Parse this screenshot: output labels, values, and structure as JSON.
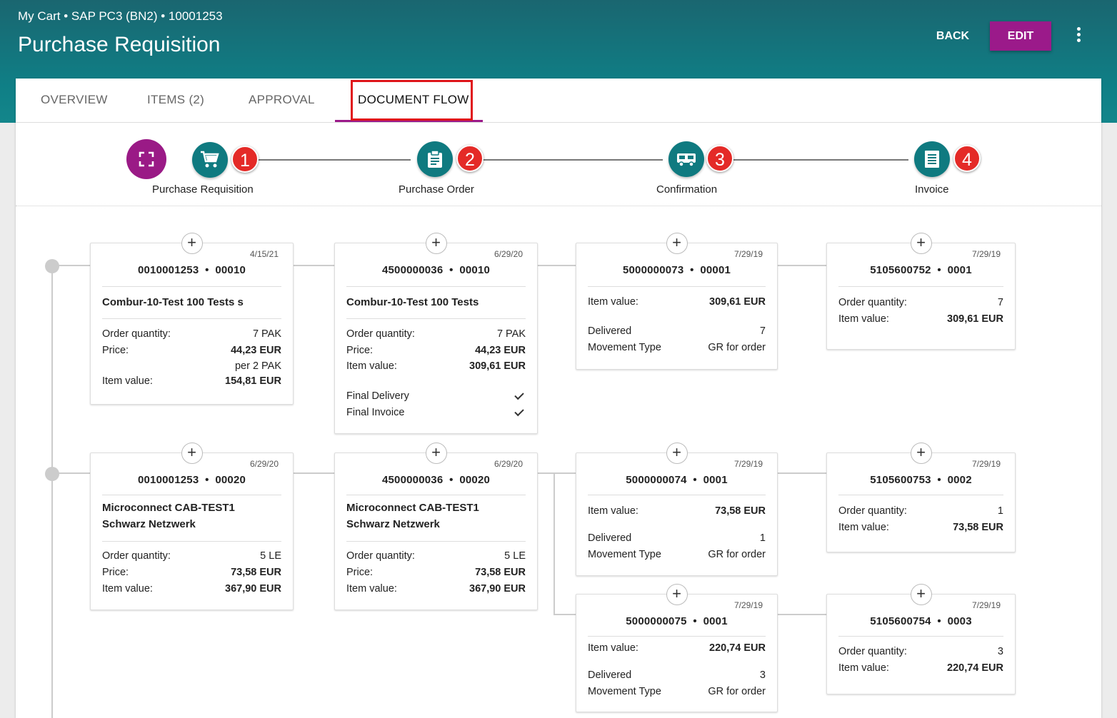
{
  "header": {
    "breadcrumb": "My Cart • SAP PC3 (BN2) • 10001253",
    "title": "Purchase Requisition",
    "back_label": "BACK",
    "edit_label": "EDIT"
  },
  "tabs": [
    {
      "label": "OVERVIEW"
    },
    {
      "label": "ITEMS (2)"
    },
    {
      "label": "APPROVAL"
    },
    {
      "label": "DOCUMENT FLOW"
    }
  ],
  "steps": [
    {
      "label": "Purchase Requisition",
      "badge": "1",
      "icon": "cart-icon"
    },
    {
      "label": "Purchase Order",
      "badge": "2",
      "icon": "clipboard-icon"
    },
    {
      "label": "Confirmation",
      "badge": "3",
      "icon": "truck-icon"
    },
    {
      "label": "Invoice",
      "badge": "4",
      "icon": "document-icon"
    }
  ],
  "docs": {
    "pr1": {
      "date": "4/15/21",
      "number": "0010001253",
      "item": "00010",
      "name": "Combur-10-Test 100 Tests s",
      "qty_label": "Order quantity:",
      "qty": "7 PAK",
      "price_label": "Price:",
      "price": "44,23 EUR",
      "per": "per 2 PAK",
      "value_label": "Item value:",
      "value": "154,81 EUR"
    },
    "po1": {
      "date": "6/29/20",
      "number": "4500000036",
      "item": "00010",
      "name": "Combur-10-Test 100 Tests",
      "qty_label": "Order quantity:",
      "qty": "7 PAK",
      "price_label": "Price:",
      "price": "44,23 EUR",
      "value_label": "Item value:",
      "value": "309,61 EUR",
      "final_delivery": "Final Delivery",
      "final_invoice": "Final Invoice"
    },
    "cf1": {
      "date": "7/29/19",
      "number": "5000000073",
      "item": "00001",
      "value_label": "Item value:",
      "value": "309,61 EUR",
      "delivered_label": "Delivered",
      "delivered": "7",
      "movement_label": "Movement Type",
      "movement": "GR for order"
    },
    "iv1": {
      "date": "7/29/19",
      "number": "5105600752",
      "item": "0001",
      "qty_label": "Order quantity:",
      "qty": "7",
      "value_label": "Item value:",
      "value": "309,61 EUR"
    },
    "pr2": {
      "date": "6/29/20",
      "number": "0010001253",
      "item": "00020",
      "name1": "Microconnect CAB-TEST1",
      "name2": "Schwarz Netzwerk",
      "qty_label": "Order quantity:",
      "qty": "5 LE",
      "price_label": "Price:",
      "price": "73,58 EUR",
      "value_label": "Item value:",
      "value": "367,90 EUR"
    },
    "po2": {
      "date": "6/29/20",
      "number": "4500000036",
      "item": "00020",
      "name1": "Microconnect CAB-TEST1",
      "name2": "Schwarz Netzwerk",
      "qty_label": "Order quantity:",
      "qty": "5 LE",
      "price_label": "Price:",
      "price": "73,58 EUR",
      "value_label": "Item value:",
      "value": "367,90 EUR"
    },
    "cf2": {
      "date": "7/29/19",
      "number": "5000000074",
      "item": "0001",
      "value_label": "Item value:",
      "value": "73,58 EUR",
      "delivered_label": "Delivered",
      "delivered": "1",
      "movement_label": "Movement Type",
      "movement": "GR for order"
    },
    "iv2": {
      "date": "7/29/19",
      "number": "5105600753",
      "item": "0002",
      "qty_label": "Order quantity:",
      "qty": "1",
      "value_label": "Item value:",
      "value": "73,58 EUR"
    },
    "cf3": {
      "date": "7/29/19",
      "number": "5000000075",
      "item": "0001",
      "value_label": "Item value:",
      "value": "220,74 EUR",
      "delivered_label": "Delivered",
      "delivered": "3",
      "movement_label": "Movement Type",
      "movement": "GR for order"
    },
    "iv3": {
      "date": "7/29/19",
      "number": "5105600754",
      "item": "0003",
      "qty_label": "Order quantity:",
      "qty": "3",
      "value_label": "Item value:",
      "value": "220,74 EUR"
    }
  },
  "colors": {
    "header": "#0f7f86",
    "accent": "#9b1a8a",
    "badge": "#e42a27",
    "highlight": "#e0161b"
  }
}
